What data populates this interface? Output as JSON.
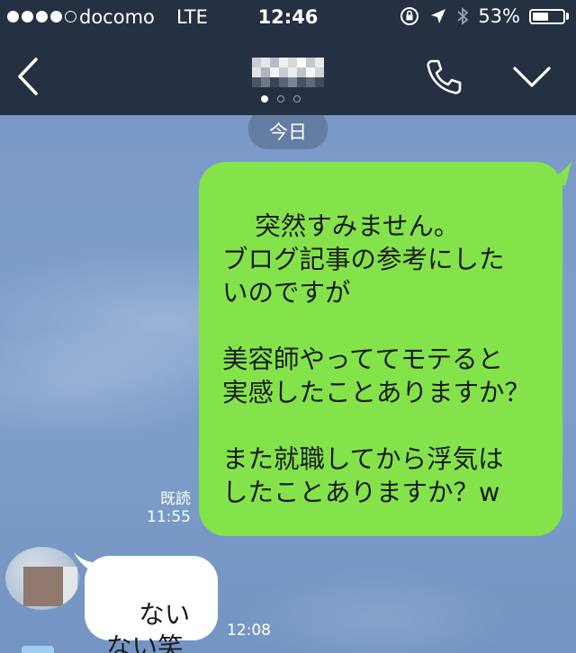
{
  "status_bar": {
    "carrier": "docomo",
    "network": "LTE",
    "time": "12:46",
    "battery": "53%",
    "battery_level": 0.53,
    "icons": [
      "rotation-lock-icon",
      "location-arrow-icon",
      "bluetooth-icon",
      "battery-icon"
    ]
  },
  "nav": {
    "back_icon": "chevron-left-icon",
    "call_icon": "phone-icon",
    "menu_icon": "chevron-down-icon",
    "page_index": 0,
    "page_count": 3
  },
  "chat": {
    "date_label": "今日",
    "messages": [
      {
        "direction": "outgoing",
        "text": "突然すみません。\nブログ記事の参考にした\nいのですが\n\n美容師やっててモテると\n実感したことありますか？\n\nまた就職してから浮気は\nしたことありますか？w",
        "read_label": "既読",
        "time": "11:55"
      },
      {
        "direction": "incoming",
        "text": "ない\nない笑",
        "time": "12:08"
      }
    ]
  },
  "colors": {
    "header_bg": "#253042",
    "chat_bg": "#7d9bc7",
    "outgoing_bubble": "#84e34a",
    "incoming_bubble": "#ffffff",
    "text": "#1b1b1b"
  }
}
